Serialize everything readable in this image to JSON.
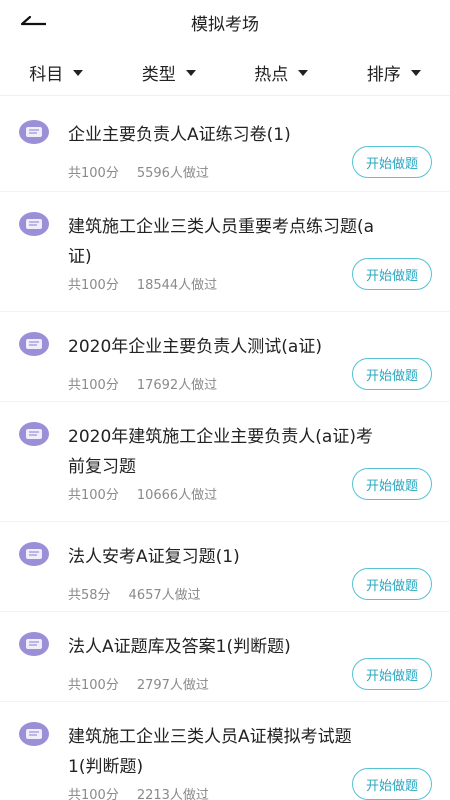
{
  "header": {
    "title": "模拟考场"
  },
  "filters": [
    {
      "label": "科目"
    },
    {
      "label": "类型"
    },
    {
      "label": "热点"
    },
    {
      "label": "排序"
    }
  ],
  "start_label": "开始做题",
  "items": [
    {
      "title": "企业主要负责人A证练习卷(1)",
      "score": "共100分",
      "count": "5596人做过"
    },
    {
      "title": "建筑施工企业三类人员重要考点练习题(a证)",
      "score": "共100分",
      "count": "18544人做过"
    },
    {
      "title": "2020年企业主要负责人测试(a证)",
      "score": "共100分",
      "count": "17692人做过"
    },
    {
      "title": "2020年建筑施工企业主要负责人(a证)考前复习题",
      "score": "共100分",
      "count": "10666人做过"
    },
    {
      "title": "法人安考A证复习题(1)",
      "score": "共58分",
      "count": "4657人做过"
    },
    {
      "title": "法人A证题库及答案1(判断题)",
      "score": "共100分",
      "count": "2797人做过"
    },
    {
      "title": "建筑施工企业三类人员A证模拟考试题1(判断题)",
      "score": "共100分",
      "count": "2213人做过"
    }
  ],
  "colors": {
    "accent": "#2aa7c0",
    "icon": "#9b8fd8"
  }
}
